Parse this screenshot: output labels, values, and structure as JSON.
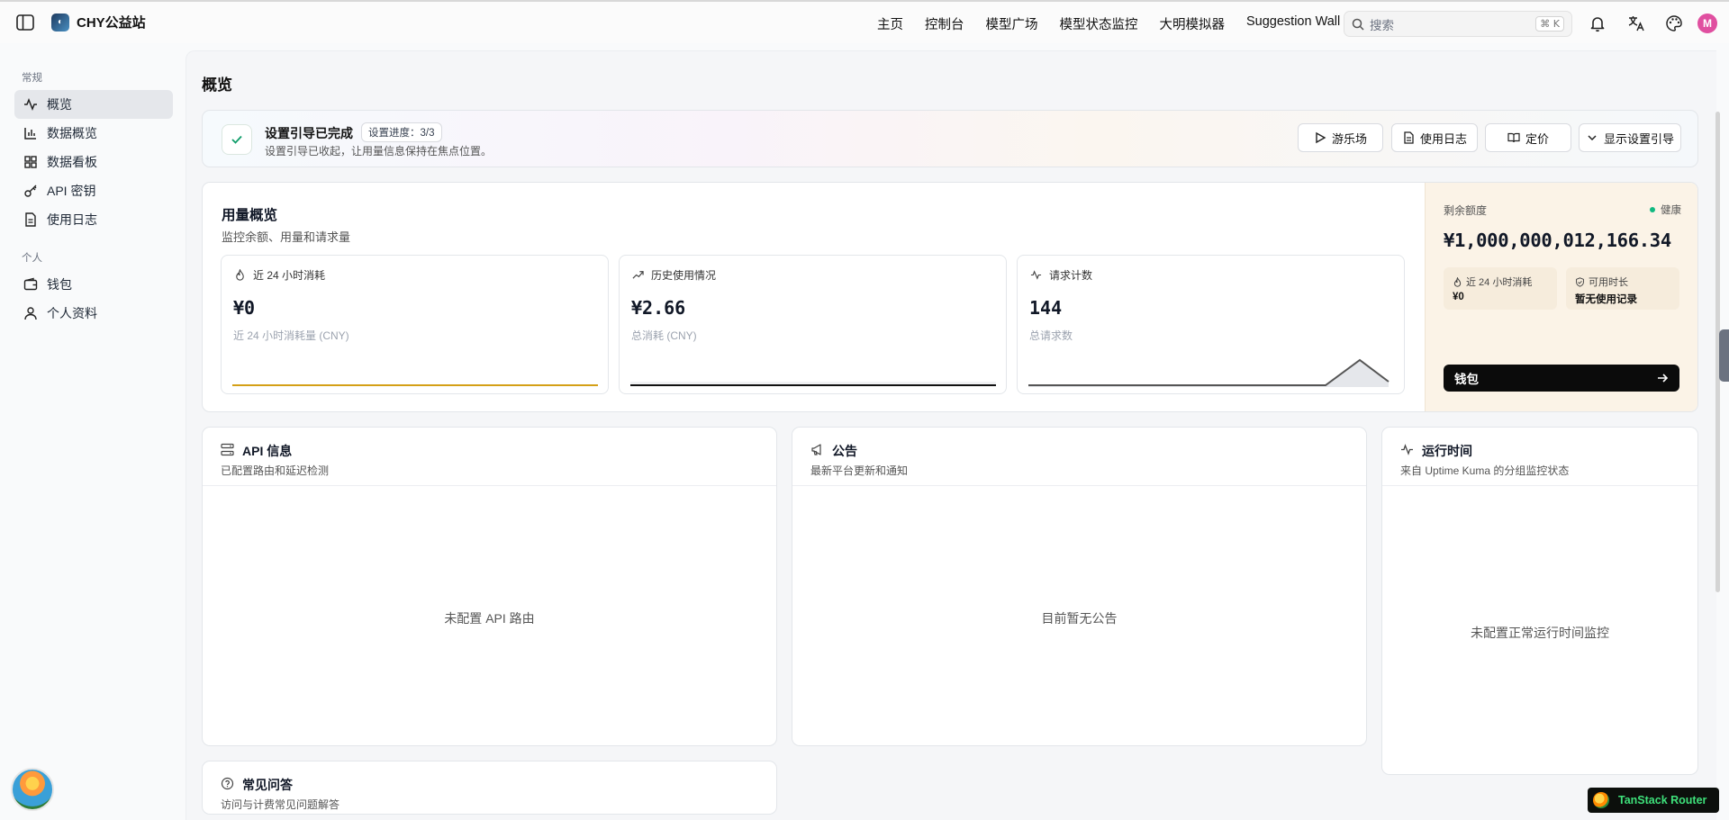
{
  "app": {
    "brand": "CHY公益站"
  },
  "nav": {
    "items": [
      "主页",
      "控制台",
      "模型广场",
      "模型状态监控",
      "大明模拟器",
      "Suggestion Wall"
    ]
  },
  "search": {
    "placeholder": "搜索",
    "shortcut": "⌘ K"
  },
  "user": {
    "avatar_letter": "M"
  },
  "sidebar": {
    "group_general": "常规",
    "group_personal": "个人",
    "general_items": [
      {
        "label": "概览",
        "icon": "activity-icon",
        "active": true
      },
      {
        "label": "数据概览",
        "icon": "bar-chart-icon"
      },
      {
        "label": "数据看板",
        "icon": "dashboard-grid-icon"
      },
      {
        "label": "API 密钥",
        "icon": "key-icon"
      },
      {
        "label": "使用日志",
        "icon": "file-text-icon"
      }
    ],
    "personal_items": [
      {
        "label": "钱包",
        "icon": "wallet-icon"
      },
      {
        "label": "个人资料",
        "icon": "user-icon"
      }
    ]
  },
  "page": {
    "title": "概览"
  },
  "guide": {
    "title": "设置引导已完成",
    "progress": "设置进度：3/3",
    "subtitle": "设置引导已收起，让用量信息保持在焦点位置。",
    "buttons": {
      "playground": "游乐场",
      "logs": "使用日志",
      "pricing": "定价",
      "show_guide": "显示设置引导"
    }
  },
  "usage": {
    "title": "用量概览",
    "subtitle": "监控余额、用量和请求量",
    "metrics": [
      {
        "label": "近 24 小时消耗",
        "value": "¥0",
        "desc": "近 24 小时消耗量 (CNY)",
        "color": "#d4a017"
      },
      {
        "label": "历史使用情况",
        "value": "¥2.66",
        "desc": "总消耗 (CNY)",
        "color": "#111111"
      },
      {
        "label": "请求计数",
        "value": "144",
        "desc": "总请求数",
        "color": "#555555"
      }
    ],
    "balance": {
      "label": "剩余额度",
      "status": "健康",
      "value": "¥1,000,000,012,166.34",
      "mini": [
        {
          "label": "近 24 小时消耗",
          "value": "¥0"
        },
        {
          "label": "可用时长",
          "value": "暂无使用记录"
        }
      ],
      "wallet_button": "钱包"
    }
  },
  "cards": {
    "api": {
      "title": "API 信息",
      "subtitle": "已配置路由和延迟检测",
      "empty": "未配置 API 路由"
    },
    "notice": {
      "title": "公告",
      "subtitle": "最新平台更新和通知",
      "empty": "目前暂无公告"
    },
    "uptime": {
      "title": "运行时间",
      "subtitle": "来自 Uptime Kuma 的分组监控状态",
      "empty": "未配置正常运行时间监控"
    },
    "faq": {
      "title": "常见问答",
      "subtitle": "访问与计费常见问题解答"
    }
  },
  "devtools": {
    "label": "TanStack Router"
  }
}
